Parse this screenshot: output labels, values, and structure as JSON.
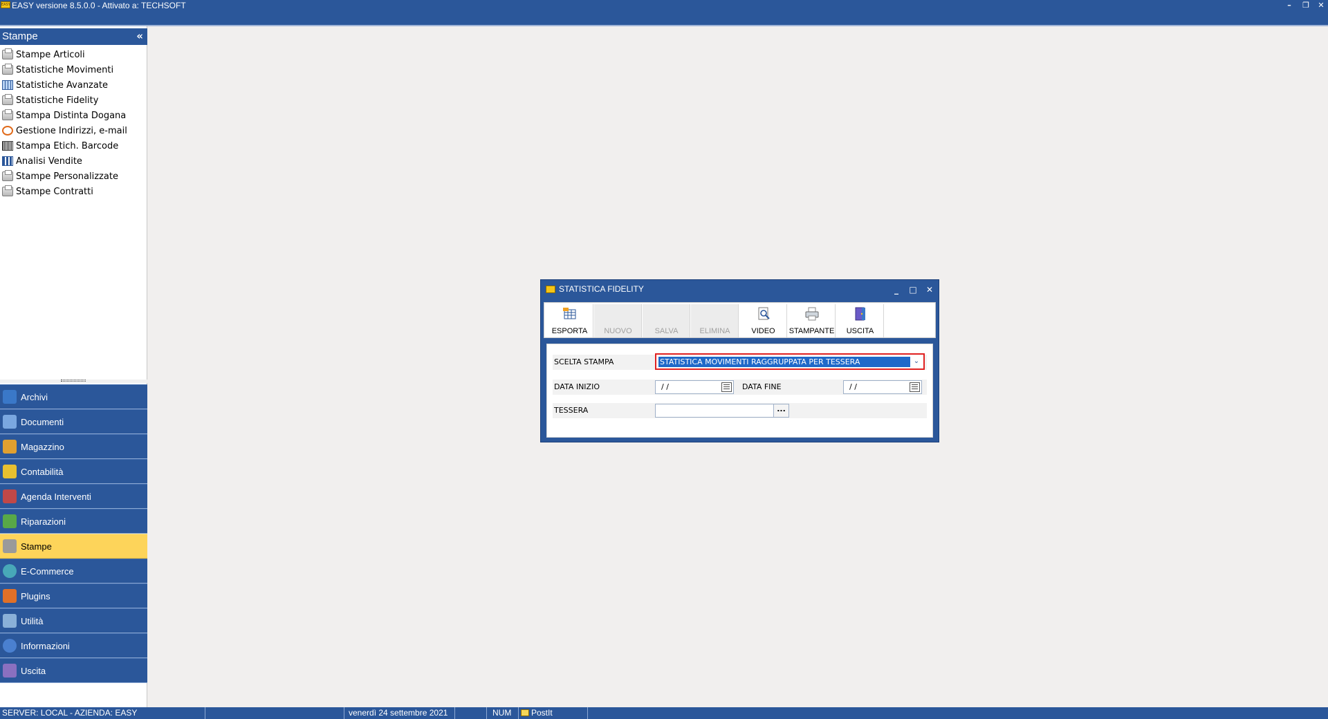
{
  "window": {
    "title": "EASY versione 8.5.0.0 - Attivato a: TECHSOFT",
    "icon": "app-logo-icon"
  },
  "sidebar": {
    "header": "Stampe",
    "collapse_glyph": "«",
    "items": [
      {
        "label": "Stampe Articoli",
        "icon": "printer-icon"
      },
      {
        "label": "Statistiche Movimenti",
        "icon": "printer-icon"
      },
      {
        "label": "Statistiche Avanzate",
        "icon": "table-icon"
      },
      {
        "label": "Statistiche Fidelity",
        "icon": "printer-icon"
      },
      {
        "label": "Stampa Distinta Dogana",
        "icon": "printer-icon"
      },
      {
        "label": "Gestione Indirizzi, e-mail",
        "icon": "address-icon"
      },
      {
        "label": "Stampa Etich. Barcode",
        "icon": "barcode-icon"
      },
      {
        "label": "Analisi Vendite",
        "icon": "chart-icon"
      },
      {
        "label": "Stampe Personalizzate",
        "icon": "printer-icon"
      },
      {
        "label": "Stampe Contratti",
        "icon": "printer-icon"
      }
    ],
    "modules": [
      {
        "label": "Archivi",
        "icon": "archive-icon",
        "color": "#3a78c8"
      },
      {
        "label": "Documenti",
        "icon": "document-icon",
        "color": "#7aa7e0"
      },
      {
        "label": "Magazzino",
        "icon": "warehouse-icon",
        "color": "#e0a030"
      },
      {
        "label": "Contabilità",
        "icon": "scales-icon",
        "color": "#e8c030"
      },
      {
        "label": "Agenda Interventi",
        "icon": "agenda-icon",
        "color": "#c04848"
      },
      {
        "label": "Riparazioni",
        "icon": "repair-icon",
        "color": "#58a848"
      },
      {
        "label": "Stampe",
        "icon": "printer-icon",
        "color": "#9a9a9a",
        "active": true
      },
      {
        "label": "E-Commerce",
        "icon": "globe-icon",
        "color": "#48a8b8"
      },
      {
        "label": "Plugins",
        "icon": "plugin-icon",
        "color": "#e07028"
      },
      {
        "label": "Utilità",
        "icon": "tools-icon",
        "color": "#8ab0d8"
      },
      {
        "label": "Informazioni",
        "icon": "info-icon",
        "color": "#4a80d0"
      },
      {
        "label": "Uscita",
        "icon": "exit-icon",
        "color": "#8a70c0"
      }
    ]
  },
  "statusbar": {
    "server": "SERVER: LOCAL - AZIENDA: EASY",
    "empty1": "",
    "date": "venerdì 24 settembre 2021",
    "empty2": "",
    "num": "NUM",
    "postit": "PostIt"
  },
  "dialog": {
    "title": "STATISTICA FIDELITY",
    "toolbar": [
      {
        "label": "ESPORTA",
        "icon": "export-icon",
        "enabled": true
      },
      {
        "label": "NUOVO",
        "icon": "new-icon",
        "enabled": false
      },
      {
        "label": "SALVA",
        "icon": "save-icon",
        "enabled": false
      },
      {
        "label": "ELIMINA",
        "icon": "delete-icon",
        "enabled": false
      },
      {
        "label": "VIDEO",
        "icon": "preview-icon",
        "enabled": true
      },
      {
        "label": "STAMPANTE",
        "icon": "printer-icon",
        "enabled": true
      },
      {
        "label": "USCITA",
        "icon": "exit-icon",
        "enabled": true
      }
    ],
    "form": {
      "scelta_stampa_label": "SCELTA STAMPA",
      "scelta_stampa_value": "STATISTICA MOVIMENTI RAGGRUPPATA PER TESSERA",
      "data_inizio_label": "DATA INIZIO",
      "data_inizio_value": "/ /",
      "data_fine_label": "DATA FINE",
      "data_fine_value": "/ /",
      "tessera_label": "TESSERA",
      "tessera_value": "",
      "tessera_button": "..."
    }
  },
  "colors": {
    "chrome": "#2b579a",
    "active_module": "#fdd45a",
    "workspace": "#f1efee",
    "selection": "#1f69c9",
    "focus_border": "#e02020"
  }
}
